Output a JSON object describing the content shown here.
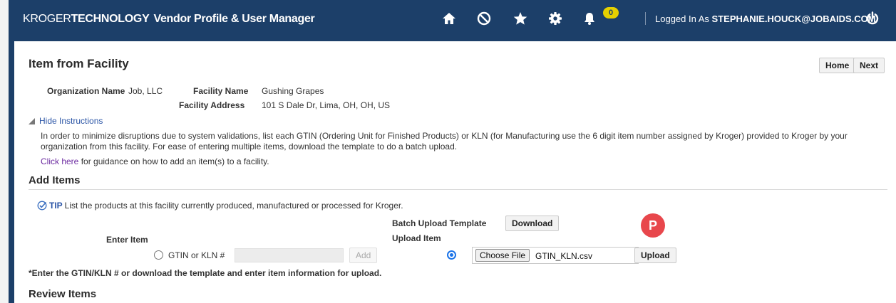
{
  "header": {
    "brand_kroger": "KROGER",
    "brand_technology": "TECHNOLOGY",
    "app_title": "Vendor Profile & User Manager",
    "icons": [
      "home-icon",
      "cancel-icon",
      "star-icon",
      "gear-icon",
      "bell-icon",
      "power-icon"
    ],
    "notification_count": "0",
    "logged_in_prefix": "Logged In As",
    "logged_in_user": "STEPHANIE.HOUCK@JOBAIDS.COM",
    "colors": {
      "bar": "#1c3f69",
      "badge": "#e5d000"
    }
  },
  "page": {
    "title": "Item from Facility",
    "home_button": "Home",
    "next_button": "Next"
  },
  "org": {
    "org_name_label": "Organization Name",
    "org_name_value": "Job, LLC",
    "facility_name_label": "Facility Name",
    "facility_name_value": "Gushing Grapes",
    "facility_address_label": "Facility Address",
    "facility_address_value": "101 S Dale Dr, Lima, OH, OH, US"
  },
  "instructions": {
    "toggle_label": "Hide Instructions",
    "text": "In order to minimize disruptions due to system validations, list each GTIN (Ordering Unit for Finished Products) or KLN (for Manufacturing use the 6 digit item number assigned by Kroger) provided to Kroger by your organization from this facility. For ease of entering multiple items, download the template to do a batch upload.",
    "link_text": "Click here",
    "link_suffix": "for guidance on how to add an item(s) to a facility."
  },
  "add_items": {
    "heading": "Add Items",
    "tip_label": "TIP",
    "tip_text": "List the products at this facility currently produced, manufactured or processed for Kroger.",
    "batch_template_label": "Batch Upload Template",
    "download_button": "Download",
    "enter_item_label": "Enter Item",
    "upload_item_label": "Upload Item",
    "gtin_radio_label": "GTIN or KLN #",
    "gtin_value": "",
    "add_button": "Add",
    "choose_file_button": "Choose File",
    "chosen_file": "GTIN_KLN.csv",
    "upload_button": "Upload",
    "marker_letter": "P",
    "footnote": "*Enter the GTIN/KLN # or download the template and enter item information for upload."
  },
  "review_items": {
    "heading": "Review Items"
  }
}
